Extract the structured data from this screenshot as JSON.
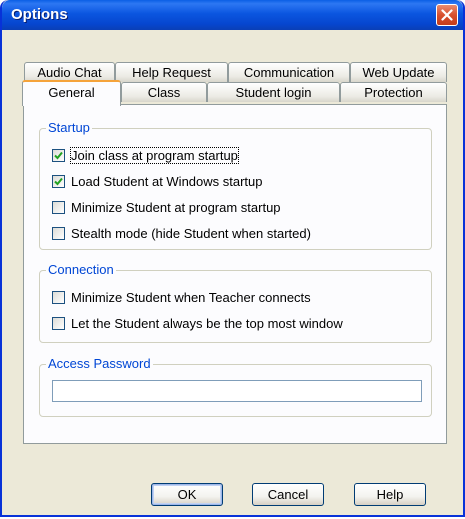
{
  "window": {
    "title": "Options"
  },
  "tabs": {
    "row1": [
      "Audio Chat",
      "Help Request",
      "Communication",
      "Web Update"
    ],
    "row2": [
      "General",
      "Class",
      "Student login",
      "Protection"
    ],
    "active": "General"
  },
  "startup": {
    "label": "Startup",
    "options": [
      {
        "label": "Join class at program startup",
        "checked": true
      },
      {
        "label": "Load Student at Windows startup",
        "checked": true
      },
      {
        "label": "Minimize Student at program startup",
        "checked": false
      },
      {
        "label": "Stealth mode (hide Student when started)",
        "checked": false
      }
    ]
  },
  "connection": {
    "label": "Connection",
    "options": [
      {
        "label": "Minimize Student when Teacher connects",
        "checked": false
      },
      {
        "label": "Let the Student always be the top most window",
        "checked": false
      }
    ]
  },
  "access_password": {
    "label": "Access Password",
    "value": "",
    "placeholder": ""
  },
  "buttons": {
    "ok": "OK",
    "cancel": "Cancel",
    "help": "Help"
  },
  "colors": {
    "titlebar": "#0a55e0",
    "group_label": "#0046d5",
    "close_button": "#d8502e",
    "active_tab_highlight": "#f5a33a"
  }
}
